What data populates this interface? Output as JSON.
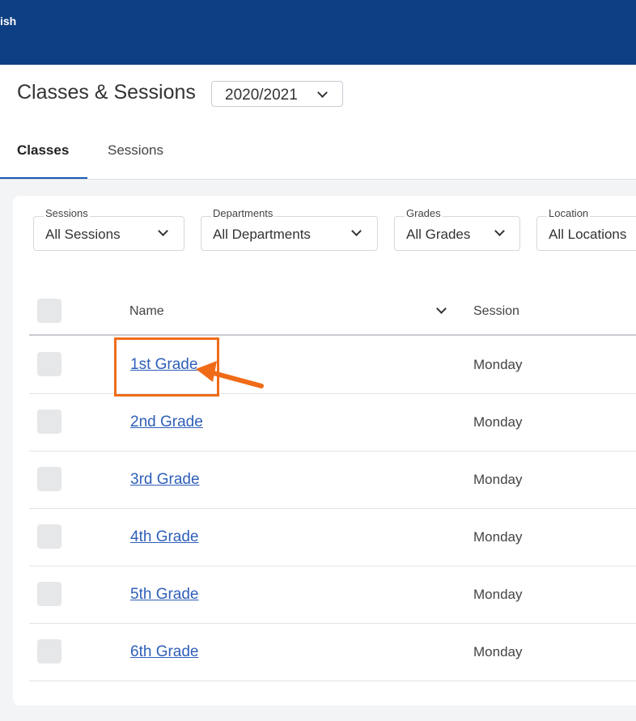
{
  "topbar": {
    "text": "ish"
  },
  "header": {
    "title": "Classes & Sessions",
    "year_select": {
      "value": "2020/2021"
    }
  },
  "tabs": [
    {
      "label": "Classes",
      "active": true
    },
    {
      "label": "Sessions",
      "active": false
    }
  ],
  "filters": [
    {
      "label": "Sessions",
      "value": "All Sessions"
    },
    {
      "label": "Departments",
      "value": "All Departments"
    },
    {
      "label": "Grades",
      "value": "All Grades"
    },
    {
      "label": "Location",
      "value": "All Locations"
    }
  ],
  "table": {
    "columns": [
      "Name",
      "Session"
    ],
    "rows": [
      {
        "name": "1st Grade",
        "session": "Monday"
      },
      {
        "name": "2nd Grade",
        "session": "Monday"
      },
      {
        "name": "3rd Grade",
        "session": "Monday"
      },
      {
        "name": "4th Grade",
        "session": "Monday"
      },
      {
        "name": "5th Grade",
        "session": "Monday"
      },
      {
        "name": "6th Grade",
        "session": "Monday"
      }
    ]
  },
  "colors": {
    "topbar": "#0e3f82",
    "link": "#2f5fb8",
    "annotation": "#f06b17",
    "active_tab_underline": "#1a5bb5"
  }
}
